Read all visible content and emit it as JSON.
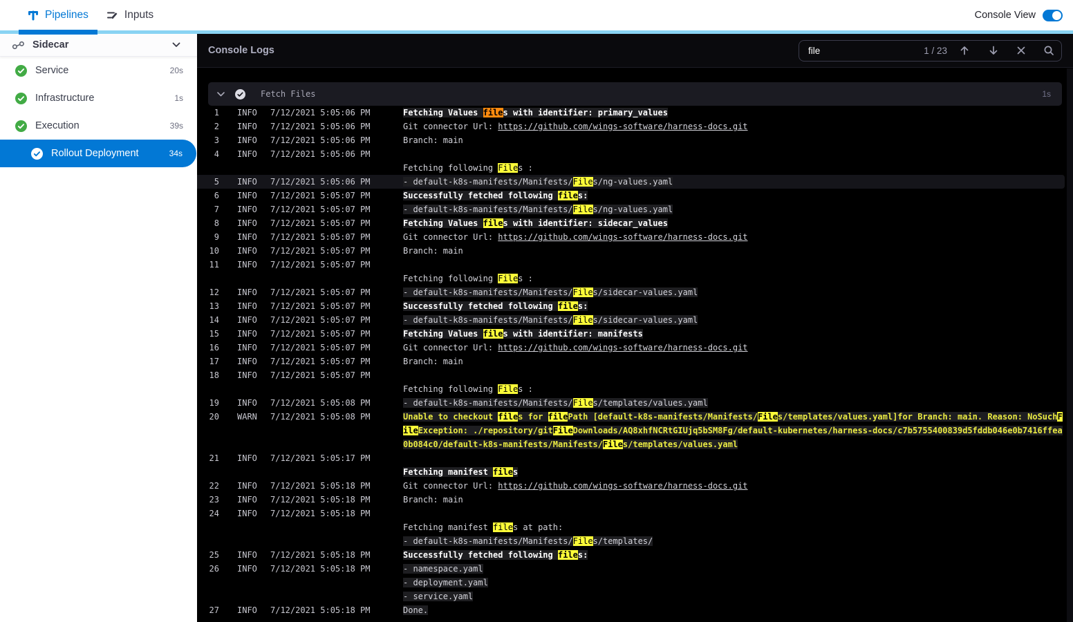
{
  "topbar": {
    "tabs": [
      {
        "label": "Pipelines",
        "icon": "pipelines-icon",
        "active": true
      },
      {
        "label": "Inputs",
        "icon": "inputs-icon",
        "active": false
      }
    ],
    "console_view_label": "Console View",
    "console_view_on": true
  },
  "sidebar": {
    "group": {
      "label": "Sidecar",
      "icon": "sidecar-icon"
    },
    "items": [
      {
        "label": "Service",
        "duration": "20s",
        "status": "success"
      },
      {
        "label": "Infrastructure",
        "duration": "1s",
        "status": "success"
      },
      {
        "label": "Execution",
        "duration": "39s",
        "status": "success"
      },
      {
        "label": "Rollout Deployment",
        "duration": "34s",
        "status": "success",
        "selected": true
      }
    ]
  },
  "console": {
    "title": "Console Logs",
    "search": {
      "value": "file",
      "counter": "1 / 23"
    },
    "section": {
      "title": "Fetch Files",
      "duration": "1s"
    },
    "colors": {
      "accent": "#0278D5",
      "success": "#42AB45",
      "highlight": "#FBFB38",
      "current_match": "#FE8A0E",
      "warn": "#E9E943"
    },
    "rows": [
      {
        "num": "1",
        "level": "INFO",
        "time": "7/12/2021 5:05:06 PM",
        "bold": true,
        "band": true,
        "parts": [
          {
            "t": "Fetching Values "
          },
          {
            "t": "file",
            "m": "cur"
          },
          {
            "t": "s with identifier: primary_values"
          }
        ]
      },
      {
        "num": "2",
        "level": "INFO",
        "time": "7/12/2021 5:05:06 PM",
        "parts": [
          {
            "t": "Git connector Url: "
          },
          {
            "t": "https://github.com/wings-software/harness-docs.git",
            "link": true
          }
        ]
      },
      {
        "num": "3",
        "level": "INFO",
        "time": "7/12/2021 5:05:06 PM",
        "parts": [
          {
            "t": "Branch: main"
          }
        ]
      },
      {
        "num": "4",
        "level": "INFO",
        "time": "7/12/2021 5:05:06 PM",
        "parts": []
      },
      {
        "parts": [
          {
            "t": "Fetching following "
          },
          {
            "t": "File",
            "m": "y"
          },
          {
            "t": "s :"
          }
        ]
      },
      {
        "num": "5",
        "level": "INFO",
        "time": "7/12/2021 5:05:06 PM",
        "sel": true,
        "band": true,
        "parts": [
          {
            "t": "- default-k8s-manifests/Manifests/"
          },
          {
            "t": "File",
            "m": "y"
          },
          {
            "t": "s/ng-values.yaml"
          }
        ]
      },
      {
        "num": "6",
        "level": "INFO",
        "time": "7/12/2021 5:05:07 PM",
        "bold": true,
        "band": true,
        "parts": [
          {
            "t": "Successfully fetched following "
          },
          {
            "t": "file",
            "m": "y"
          },
          {
            "t": "s:"
          }
        ]
      },
      {
        "num": "7",
        "level": "INFO",
        "time": "7/12/2021 5:05:07 PM",
        "band": true,
        "parts": [
          {
            "t": "- default-k8s-manifests/Manifests/"
          },
          {
            "t": "File",
            "m": "y"
          },
          {
            "t": "s/ng-values.yaml"
          }
        ]
      },
      {
        "num": "8",
        "level": "INFO",
        "time": "7/12/2021 5:05:07 PM",
        "bold": true,
        "band": true,
        "parts": [
          {
            "t": "Fetching Values "
          },
          {
            "t": "file",
            "m": "y"
          },
          {
            "t": "s with identifier: sidecar_values"
          }
        ]
      },
      {
        "num": "9",
        "level": "INFO",
        "time": "7/12/2021 5:05:07 PM",
        "parts": [
          {
            "t": "Git connector Url: "
          },
          {
            "t": "https://github.com/wings-software/harness-docs.git",
            "link": true
          }
        ]
      },
      {
        "num": "10",
        "level": "INFO",
        "time": "7/12/2021 5:05:07 PM",
        "parts": [
          {
            "t": "Branch: main"
          }
        ]
      },
      {
        "num": "11",
        "level": "INFO",
        "time": "7/12/2021 5:05:07 PM",
        "parts": []
      },
      {
        "parts": [
          {
            "t": "Fetching following "
          },
          {
            "t": "File",
            "m": "y"
          },
          {
            "t": "s :"
          }
        ]
      },
      {
        "num": "12",
        "level": "INFO",
        "time": "7/12/2021 5:05:07 PM",
        "band": true,
        "parts": [
          {
            "t": "- default-k8s-manifests/Manifests/"
          },
          {
            "t": "File",
            "m": "y"
          },
          {
            "t": "s/sidecar-values.yaml"
          }
        ]
      },
      {
        "num": "13",
        "level": "INFO",
        "time": "7/12/2021 5:05:07 PM",
        "bold": true,
        "band": true,
        "parts": [
          {
            "t": "Successfully fetched following "
          },
          {
            "t": "file",
            "m": "y"
          },
          {
            "t": "s:"
          }
        ]
      },
      {
        "num": "14",
        "level": "INFO",
        "time": "7/12/2021 5:05:07 PM",
        "band": true,
        "parts": [
          {
            "t": "- default-k8s-manifests/Manifests/"
          },
          {
            "t": "File",
            "m": "y"
          },
          {
            "t": "s/sidecar-values.yaml"
          }
        ]
      },
      {
        "num": "15",
        "level": "INFO",
        "time": "7/12/2021 5:05:07 PM",
        "bold": true,
        "band": true,
        "parts": [
          {
            "t": "Fetching Values "
          },
          {
            "t": "file",
            "m": "y"
          },
          {
            "t": "s with identifier: manifests"
          }
        ]
      },
      {
        "num": "16",
        "level": "INFO",
        "time": "7/12/2021 5:05:07 PM",
        "parts": [
          {
            "t": "Git connector Url: "
          },
          {
            "t": "https://github.com/wings-software/harness-docs.git",
            "link": true
          }
        ]
      },
      {
        "num": "17",
        "level": "INFO",
        "time": "7/12/2021 5:05:07 PM",
        "parts": [
          {
            "t": "Branch: main"
          }
        ]
      },
      {
        "num": "18",
        "level": "INFO",
        "time": "7/12/2021 5:05:07 PM",
        "parts": []
      },
      {
        "parts": [
          {
            "t": "Fetching following "
          },
          {
            "t": "File",
            "m": "y"
          },
          {
            "t": "s :"
          }
        ]
      },
      {
        "num": "19",
        "level": "INFO",
        "time": "7/12/2021 5:05:08 PM",
        "band": true,
        "parts": [
          {
            "t": "- default-k8s-manifests/Manifests/"
          },
          {
            "t": "File",
            "m": "y"
          },
          {
            "t": "s/templates/values.yaml"
          }
        ]
      },
      {
        "num": "20",
        "level": "WARN",
        "time": "7/12/2021 5:05:08 PM",
        "warn": true,
        "band": true,
        "parts": [
          {
            "t": "Unable to checkout "
          },
          {
            "t": "file",
            "m": "y"
          },
          {
            "t": "s for "
          },
          {
            "t": "file",
            "m": "y"
          },
          {
            "t": "Path [default-k8s-manifests/Manifests/"
          },
          {
            "t": "File",
            "m": "y"
          },
          {
            "t": "s/templates/values.yaml]for Branch: main. Reason: NoSuch"
          },
          {
            "t": "F",
            "m": "y"
          }
        ]
      },
      {
        "warn": true,
        "band": true,
        "parts": [
          {
            "t": "ile",
            "m": "y"
          },
          {
            "t": "Exception: ./repository/git"
          },
          {
            "t": "File",
            "m": "y"
          },
          {
            "t": "Downloads/AQ8xhfNCRtGIUjq5bSM8Fg/default-kubernetes/harness-docs/c7b5755400839d5fddb046e0b7416ffea"
          }
        ]
      },
      {
        "warn": true,
        "band": true,
        "parts": [
          {
            "t": "0b084c0/default-k8s-manifests/Manifests/"
          },
          {
            "t": "File",
            "m": "y"
          },
          {
            "t": "s/templates/values.yaml"
          }
        ]
      },
      {
        "num": "21",
        "level": "INFO",
        "time": "7/12/2021 5:05:17 PM",
        "parts": []
      },
      {
        "bold": true,
        "band": true,
        "parts": [
          {
            "t": "Fetching manifest "
          },
          {
            "t": "file",
            "m": "y"
          },
          {
            "t": "s"
          }
        ]
      },
      {
        "num": "22",
        "level": "INFO",
        "time": "7/12/2021 5:05:18 PM",
        "parts": [
          {
            "t": "Git connector Url: "
          },
          {
            "t": "https://github.com/wings-software/harness-docs.git",
            "link": true
          }
        ]
      },
      {
        "num": "23",
        "level": "INFO",
        "time": "7/12/2021 5:05:18 PM",
        "parts": [
          {
            "t": "Branch: main"
          }
        ]
      },
      {
        "num": "24",
        "level": "INFO",
        "time": "7/12/2021 5:05:18 PM",
        "parts": []
      },
      {
        "parts": [
          {
            "t": "Fetching manifest "
          },
          {
            "t": "file",
            "m": "y"
          },
          {
            "t": "s at path:"
          }
        ]
      },
      {
        "band": true,
        "parts": [
          {
            "t": "- default-k8s-manifests/Manifests/"
          },
          {
            "t": "File",
            "m": "y"
          },
          {
            "t": "s/templates/"
          }
        ]
      },
      {
        "num": "25",
        "level": "INFO",
        "time": "7/12/2021 5:05:18 PM",
        "bold": true,
        "band": true,
        "parts": [
          {
            "t": "Successfully fetched following "
          },
          {
            "t": "file",
            "m": "y"
          },
          {
            "t": "s:"
          }
        ]
      },
      {
        "num": "26",
        "level": "INFO",
        "time": "7/12/2021 5:05:18 PM",
        "band": true,
        "parts": [
          {
            "t": "- namespace.yaml"
          }
        ]
      },
      {
        "band": true,
        "parts": [
          {
            "t": "- deployment.yaml"
          }
        ]
      },
      {
        "band": true,
        "parts": [
          {
            "t": "- service.yaml"
          }
        ]
      },
      {
        "num": "27",
        "level": "INFO",
        "time": "7/12/2021 5:05:18 PM",
        "band": true,
        "parts": [
          {
            "t": "Done."
          }
        ]
      }
    ]
  }
}
